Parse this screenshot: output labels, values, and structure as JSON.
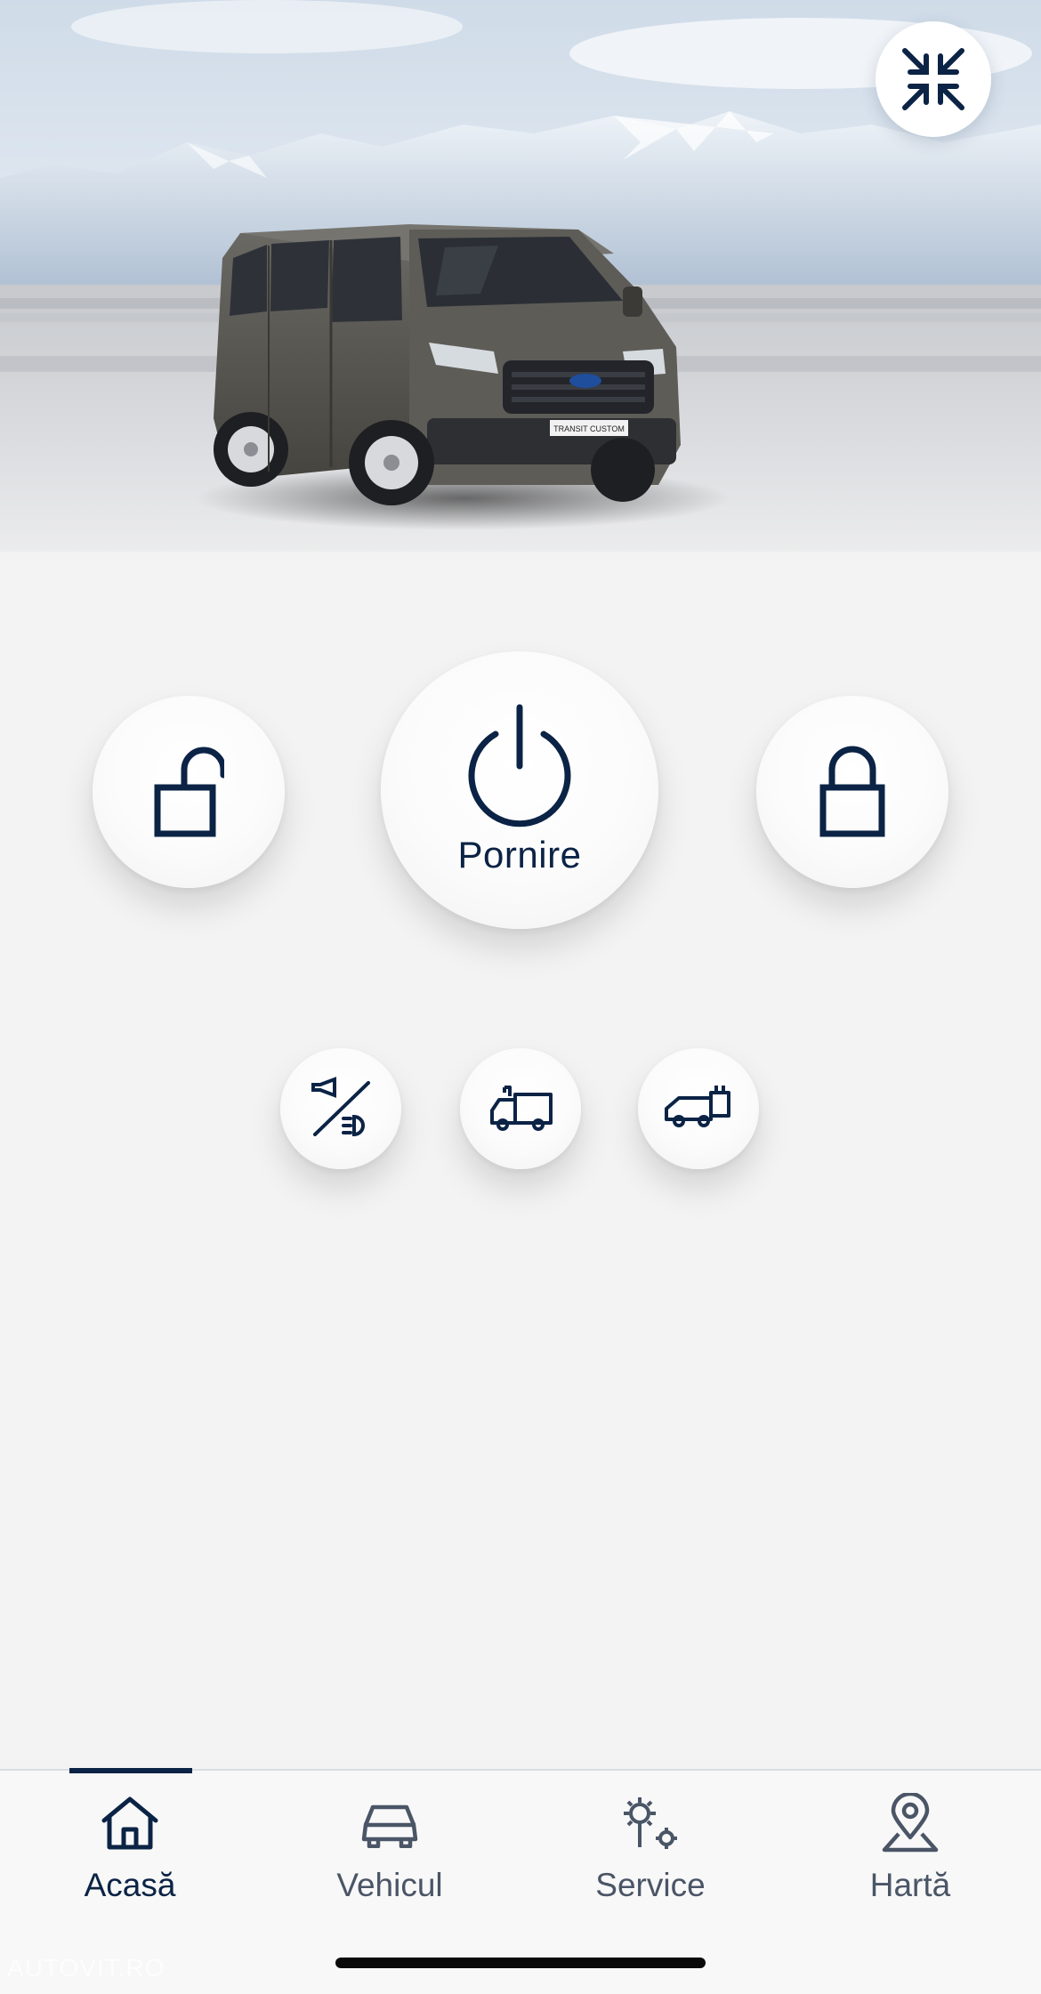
{
  "vehicle": {
    "model_badge": "TRANSIT CUSTOM"
  },
  "controls": {
    "start_label": "Pornire",
    "collapse_icon": "collapse-arrows-icon",
    "unlock_icon": "unlock-icon",
    "lock_icon": "lock-icon",
    "start_icon": "power-icon",
    "horn_lights_icon": "horn-lights-icon",
    "truck_icon": "truck-icon",
    "cargo_icon": "cargo-van-icon"
  },
  "nav": {
    "items": [
      {
        "label": "Acasă",
        "icon": "home-icon",
        "active": true
      },
      {
        "label": "Vehicul",
        "icon": "car-icon",
        "active": false
      },
      {
        "label": "Service",
        "icon": "service-gears-icon",
        "active": false
      },
      {
        "label": "Hartă",
        "icon": "map-pin-icon",
        "active": false
      }
    ]
  },
  "watermark": "AUTOVIT.RO",
  "colors": {
    "accent": "#0b2345",
    "background": "#f3f3f3",
    "van_body": "#5a5853"
  }
}
